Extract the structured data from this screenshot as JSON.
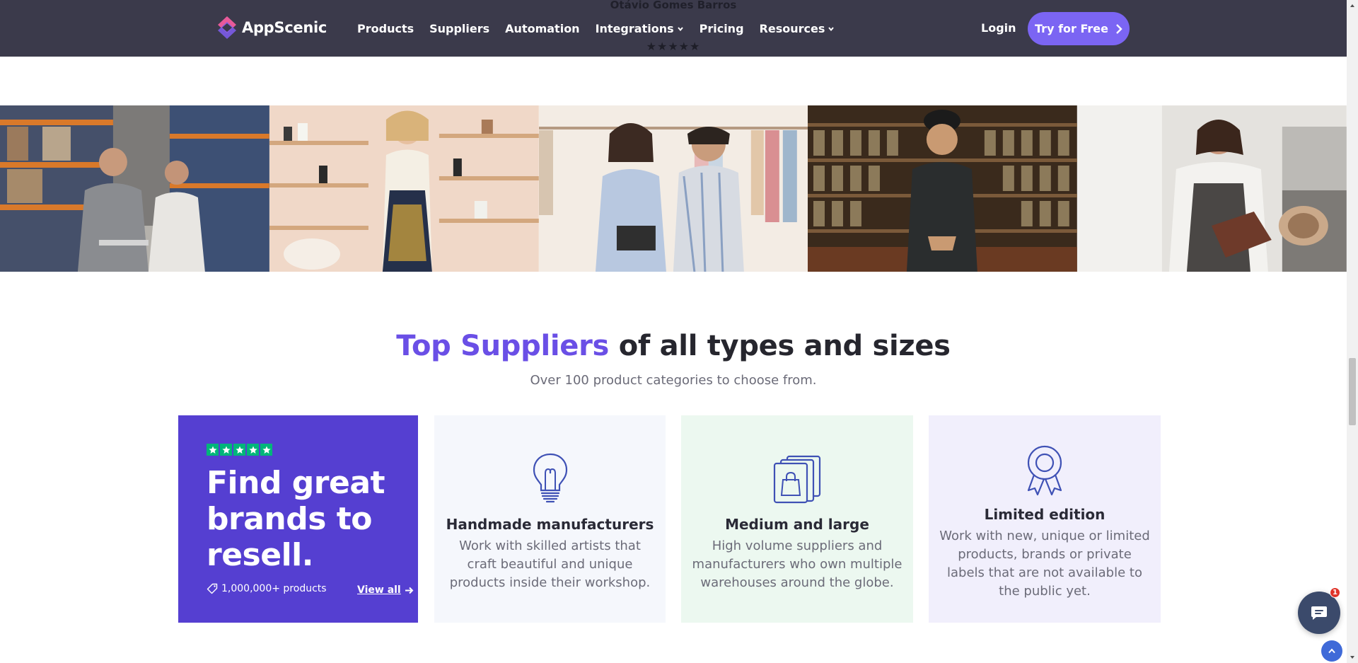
{
  "header": {
    "ghost_name": "Otávio Gomes Barros",
    "ghost_rating": "★★★★★",
    "logo_text": "AppScenic",
    "nav": [
      {
        "label": "Products",
        "dropdown": false
      },
      {
        "label": "Suppliers",
        "dropdown": false
      },
      {
        "label": "Automation",
        "dropdown": false
      },
      {
        "label": "Integrations",
        "dropdown": true
      },
      {
        "label": "Pricing",
        "dropdown": false
      },
      {
        "label": "Resources",
        "dropdown": true
      }
    ],
    "login_label": "Login",
    "cta_label": "Try for Free"
  },
  "section": {
    "title_accent": "Top Suppliers",
    "title_rest": "of all types and sizes",
    "subtitle": "Over 100 product categories to choose from."
  },
  "promo_card": {
    "rating_stars": 5,
    "headline": "Find great brands to resell.",
    "count": "1,000,000+ products",
    "link_label": "View all"
  },
  "feature_cards": [
    {
      "title": "Handmade manufacturers",
      "description": "Work with skilled artists that craft beautiful and unique products inside their workshop.",
      "icon": "lightbulb-icon"
    },
    {
      "title": "Medium and large",
      "description": "High volume suppliers and manufacturers who own multiple warehouses around the globe.",
      "icon": "shopping-bags-icon"
    },
    {
      "title": "Limited edition",
      "description": "Work with new, unique or limited products, brands or private labels that are not available to the public yet.",
      "icon": "award-ribbon-icon"
    }
  ],
  "chat": {
    "badge_count": "1"
  },
  "colors": {
    "header_bg": "#3b3a4b",
    "accent": "#6a4fe6",
    "cta": "#7b65f3",
    "promo_bg": "#553fd1",
    "trustpilot_green": "#00b67a"
  }
}
